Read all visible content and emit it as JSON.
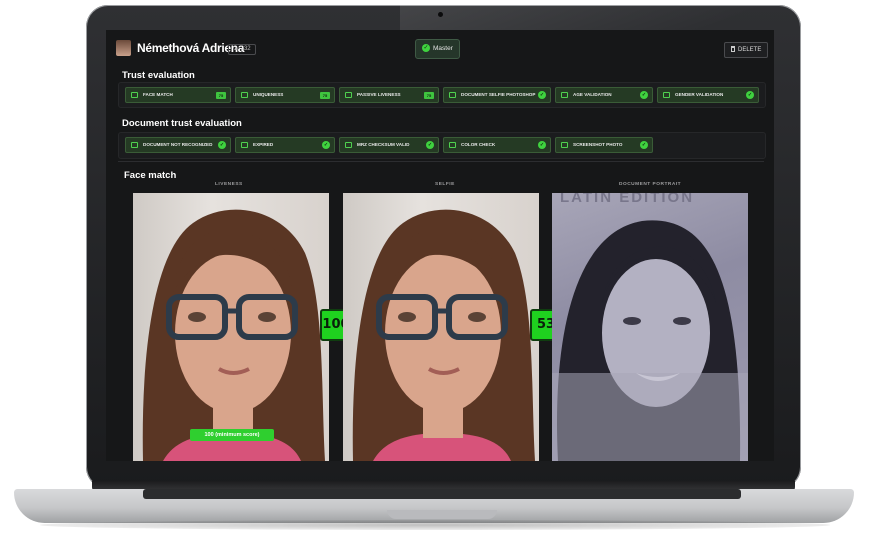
{
  "header": {
    "user_name": "Némethová Adriena",
    "history_badge": "▲ 232",
    "master_label": "Master",
    "delete_label": "DELETE"
  },
  "trust_evaluation": {
    "title": "Trust evaluation",
    "chips": [
      {
        "label": "FACE MATCH",
        "badge": "75"
      },
      {
        "label": "UNIQUENESS",
        "badge": "75"
      },
      {
        "label": "PASSIVE LIVENESS",
        "badge": "75"
      },
      {
        "label": "DOCUMENT SELFIE PHOTOSHOP",
        "badge": "✓"
      },
      {
        "label": "AGE VALIDATION",
        "badge": "✓"
      },
      {
        "label": "GENDER VALIDATION",
        "badge": "✓"
      }
    ]
  },
  "document_trust_evaluation": {
    "title": "Document trust evaluation",
    "chips": [
      {
        "label": "DOCUMENT NOT RECOGNIZED",
        "badge": "✓"
      },
      {
        "label": "EXPIRED",
        "badge": "✓"
      },
      {
        "label": "MRZ CHECKSUM VALID",
        "badge": "✓"
      },
      {
        "label": "COLOR CHECK",
        "badge": "✓"
      },
      {
        "label": "SCREENSHOT PHOTO",
        "badge": "✓"
      }
    ]
  },
  "face_match": {
    "title": "Face match",
    "columns": [
      "LIVENESS",
      "SELFIE",
      "DOCUMENT PORTRAIT"
    ],
    "scores": [
      "100",
      "53"
    ],
    "minimum_score_label": "100 (minimum score)",
    "document_watermark_text": "LATIN EDITION"
  },
  "colors": {
    "accent_green": "#2fcf2f",
    "background": "#161718",
    "chip_bg": "#253a24"
  }
}
